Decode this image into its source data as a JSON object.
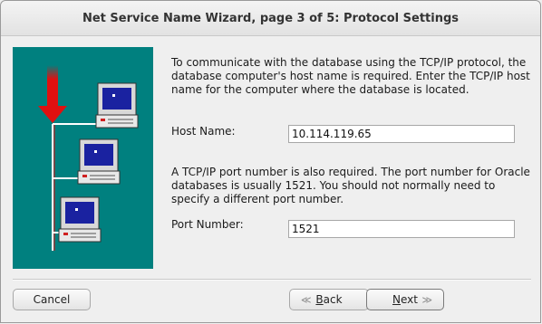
{
  "window": {
    "title": "Net Service Name Wizard, page 3 of 5: Protocol Settings"
  },
  "intro_text": "To communicate with the database using the TCP/IP protocol, the database computer's host name is required.  Enter the TCP/IP host name for the computer where the database is located.",
  "host": {
    "label": "Host Name:",
    "value": "10.114.119.65"
  },
  "port_info_text": "A TCP/IP port number is also required.  The port number for Oracle databases is usually 1521.  You should not normally need to specify a different port number.",
  "port": {
    "label": "Port Number:",
    "value": "1521"
  },
  "buttons": {
    "cancel": "Cancel",
    "back_first": "B",
    "back_rest": "ack",
    "next_first": "N",
    "next_rest": "ext"
  },
  "colors": {
    "art_background": "#00807f",
    "arrow": "#e01010",
    "screen": "#1a22a0"
  },
  "icons": {
    "back": "chevron-double-left-icon",
    "next": "chevron-double-right-icon"
  }
}
